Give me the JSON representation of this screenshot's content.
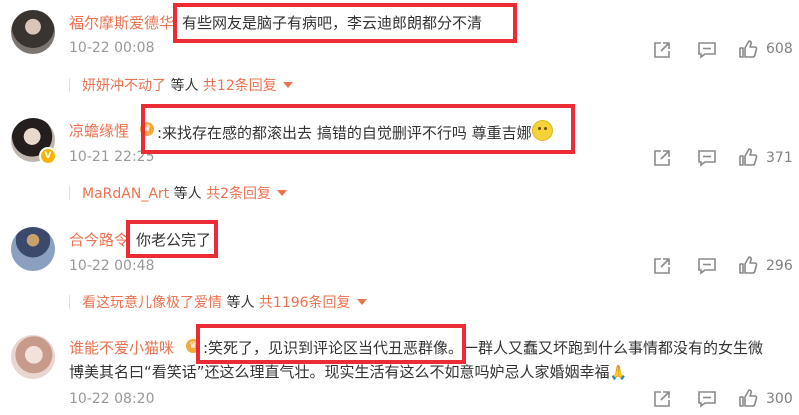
{
  "comments": [
    {
      "username": "福尔摩斯爱德华",
      "text": "有些网友是脑子有病吧，李云迪郎朗都分不清",
      "time": "10-22 00:08",
      "likes": "608",
      "reply": {
        "names": "妍妍冲不动了",
        "others": " 等人 ",
        "count_text": "共12条回复"
      }
    },
    {
      "username": "凉蟾缘惺",
      "text": ":来找存在感的都滚出去 搞错的自觉删评不行吗 尊重吉娜",
      "time": "10-21 22:25",
      "likes": "371",
      "reply": {
        "names": "MaRdAN_Art",
        "others": " 等人 ",
        "count_text": "共2条回复"
      }
    },
    {
      "username": "合今路令",
      "text": "你老公完了",
      "time": "10-22 00:48",
      "likes": "296",
      "reply": {
        "names": "看这玩意儿像极了爱情",
        "others": " 等人 ",
        "count_text": "共1196条回复"
      }
    },
    {
      "username": "谁能不爱小猫咪",
      "text_line1": ":笑死了，见识到评论区当代丑恶群像。一群人又蠢又坏跑到什么事情都没有的女生微",
      "text_line2": "博美其名曰“看笑话”还这么理直气壮。现实生活有这么不如意吗妒忌人家婚姻幸福",
      "time": "10-22 08:20",
      "likes": "300"
    }
  ],
  "icons": {
    "share": "share-icon",
    "comment": "comment-icon",
    "like": "like-icon",
    "vip_badge": "vip-badge-icon",
    "verified": "verified-v-icon",
    "smile": "smile-emoji",
    "pray": "pray-emoji"
  },
  "colors": {
    "username": "#eb7350",
    "highlight_box": "#ec2c34",
    "meta": "#999999"
  }
}
